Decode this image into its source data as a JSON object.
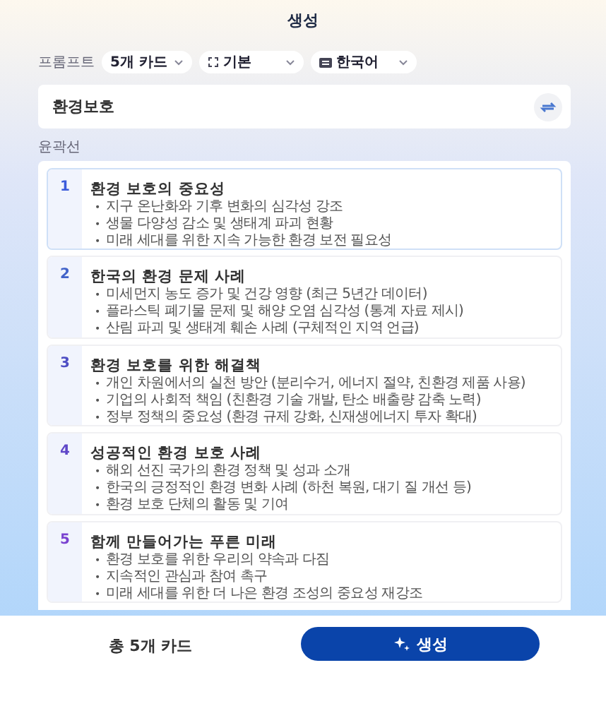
{
  "header": {
    "title": "생성"
  },
  "prompt": {
    "label": "프롬프트",
    "dropdowns": [
      {
        "kind": "plain",
        "value": "5개 카드"
      },
      {
        "kind": "frame",
        "value": "기본"
      },
      {
        "kind": "language",
        "value": "한국어"
      }
    ],
    "topic": "환경보호"
  },
  "outline": {
    "label": "윤곽선",
    "marker": "•",
    "cards": [
      {
        "number": "1",
        "title": "환경 보호의 중요성",
        "selected": true,
        "color": "#3b5bdb",
        "bullets": [
          "지구 온난화와 기후 변화의 심각성 강조",
          "생물 다양성 감소 및 생태계 파괴 현황",
          "미래 세대를 위한 지속 가능한 환경 보전 필요성"
        ]
      },
      {
        "number": "2",
        "title": "한국의 환경 문제 사례",
        "selected": false,
        "color": "#4263c9",
        "bullets": [
          "미세먼지 농도 증가 및 건강 영향 (최근 5년간 데이터)",
          "플라스틱 폐기물 문제 및 해양 오염 심각성 (통계 자료 제시)",
          "산림 파괴 및 생태계 훼손 사례 (구체적인 지역 언급)"
        ]
      },
      {
        "number": "3",
        "title": "환경 보호를 위한 해결책",
        "selected": false,
        "color": "#4f4fc4",
        "bullets": [
          "개인 차원에서의 실천 방안 (분리수거, 에너지 절약, 친환경 제품 사용)",
          "기업의 사회적 책임 (친환경 기술 개발, 탄소 배출량 감축 노력)",
          "정부 정책의 중요성 (환경 규제 강화, 신재생에너지 투자 확대)"
        ]
      },
      {
        "number": "4",
        "title": "성공적인 환경 보호 사례",
        "selected": false,
        "color": "#5f47c8",
        "bullets": [
          "해외 선진 국가의 환경 정책 및 성과 소개",
          "한국의 긍정적인 환경 변화 사례 (하천 복원, 대기 질 개선 등)",
          "환경 보호 단체의 활동 및 기여"
        ]
      },
      {
        "number": "5",
        "title": "함께 만들어가는 푸른 미래",
        "selected": false,
        "color": "#7a42d0",
        "bullets": [
          "환경 보호를 위한 우리의 약속과 다짐",
          "지속적인 관심과 참여 촉구",
          "미래 세대를 위한 더 나은 환경 조성의 중요성 재강조"
        ]
      }
    ]
  },
  "footer": {
    "count": "총 5개 카드",
    "button": "생성"
  }
}
